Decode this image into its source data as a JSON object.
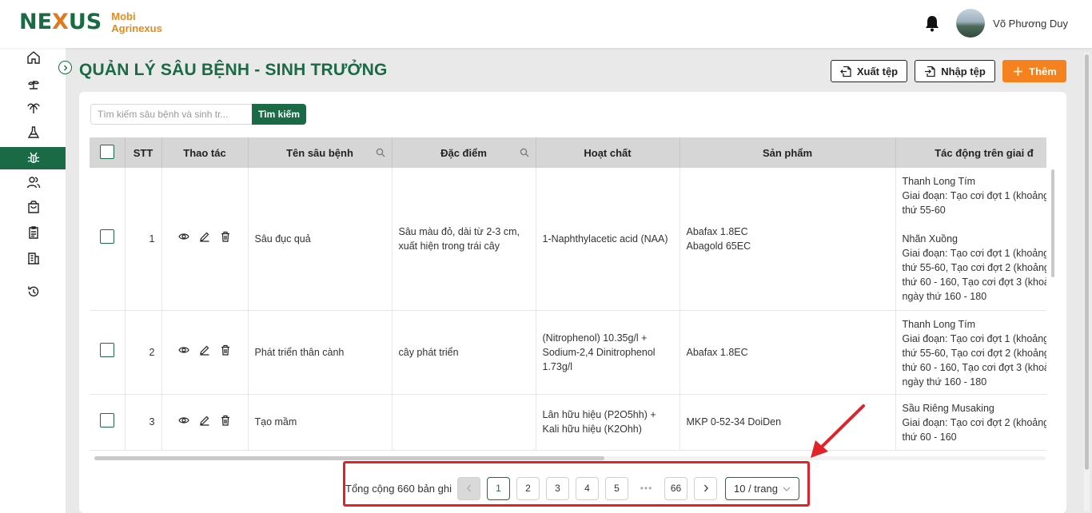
{
  "app": {
    "logo_text_1": "NE",
    "logo_text_x": "X",
    "logo_text_2": "US",
    "brand_line1": "Mobi",
    "brand_line2": "Agrinexus"
  },
  "header": {
    "user_name": "Võ Phương Duy"
  },
  "page": {
    "title": "QUẢN LÝ SÂU BỆNH - SINH TRƯỞNG",
    "export_label": "Xuất tệp",
    "import_label": "Nhập tệp",
    "add_label": "Thêm"
  },
  "search": {
    "placeholder": "Tìm kiếm sâu bệnh và sinh tr...",
    "button_label": "Tìm kiếm"
  },
  "table": {
    "columns": [
      "STT",
      "Thao tác",
      "Tên sâu bệnh",
      "Đặc điểm",
      "Hoạt chất",
      "Sản phẩm",
      "Tác động trên giai đ"
    ],
    "rows": [
      {
        "stt": "1",
        "name": "Sâu đục quả",
        "feature": "Sâu màu đỏ, dài từ 2-3 cm, xuất hiện trong trái cây",
        "ingredient": "1-Naphthylacetic acid (NAA)",
        "products": "Abafax 1.8EC\nAbagold 65EC",
        "impact": "Thanh Long Tím\nGiai đoạn: Tạo cơi đợt 1 (khoảng\nthứ 55-60\n\nNhãn Xuồng\nGiai đoạn: Tạo cơi đợt 1 (khoảng\nthứ 55-60, Tạo cơi đợt 2 (khoảng\nthứ 60 - 160, Tạo cơi đợt 3 (khoả\nngày thứ 160 - 180"
      },
      {
        "stt": "2",
        "name": "Phát triển thân cành",
        "feature": "cây phát triển",
        "ingredient": "(Nitrophenol) 10.35g/l + Sodium-2,4 Dinitrophenol 1.73g/l",
        "products": "Abafax 1.8EC",
        "impact": "Thanh Long Tím\nGiai đoạn: Tạo cơi đợt 1 (khoảng\nthứ 55-60, Tạo cơi đợt 2 (khoảng\nthứ 60 - 160, Tạo cơi đợt 3 (khoả\nngày thứ 160 - 180"
      },
      {
        "stt": "3",
        "name": "Tạo mầm",
        "feature": "",
        "ingredient": "Lân hữu hiệu (P2O5hh) + Kali hữu hiệu (K2Ohh)",
        "products": "MKP 0-52-34 DoiDen",
        "impact": "Sầu Riêng Musaking\nGiai đoạn: Tạo cơi đợt 2 (khoảng\nthứ 60 - 160"
      }
    ]
  },
  "pagination": {
    "total_text": "Tổng cộng 660 bản ghi",
    "pages": [
      "1",
      "2",
      "3",
      "4",
      "5",
      "66"
    ],
    "ellipsis": "•••",
    "current_page": "1",
    "page_size": "10 / trang"
  },
  "colors": {
    "primary": "#1a6b45",
    "accent": "#f5821f",
    "annotation": "#e0222a"
  },
  "icons": {
    "sidebar": [
      "home-icon",
      "plant-icon",
      "palm-tree-icon",
      "flask-icon",
      "bug-icon",
      "users-icon",
      "shopping-bag-icon",
      "clipboard-icon",
      "building-icon",
      "history-icon"
    ],
    "row_actions": [
      "eye-icon",
      "edit-icon",
      "trash-icon"
    ]
  }
}
